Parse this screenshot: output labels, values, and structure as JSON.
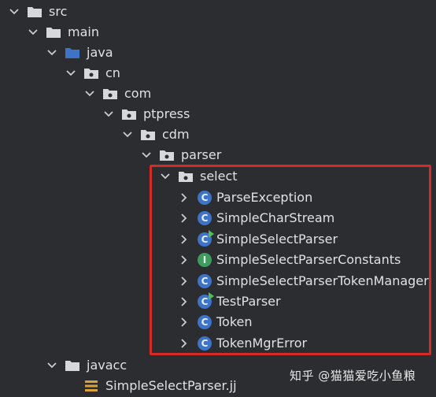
{
  "tree": {
    "src": "src",
    "main": "main",
    "java": "java",
    "cn": "cn",
    "com": "com",
    "ptpress": "ptpress",
    "cdm": "cdm",
    "parser": "parser",
    "select": "select",
    "classes": [
      {
        "label": "ParseException",
        "kind": "C"
      },
      {
        "label": "SimpleCharStream",
        "kind": "C"
      },
      {
        "label": "SimpleSelectParser",
        "kind": "C"
      },
      {
        "label": "SimpleSelectParserConstants",
        "kind": "I"
      },
      {
        "label": "SimpleSelectParserTokenManager",
        "kind": "C"
      },
      {
        "label": "TestParser",
        "kind": "C"
      },
      {
        "label": "Token",
        "kind": "C"
      },
      {
        "label": "TokenMgrError",
        "kind": "C"
      }
    ],
    "javacc": "javacc",
    "grammar_file": "SimpleSelectParser.jj"
  },
  "watermark": "知乎 @猫猫爱吃小鱼粮",
  "colors": {
    "background": "#2b2d30",
    "text": "#dfe1e5",
    "class_icon": "#3d74c7",
    "interface_icon": "#3f9a5e",
    "highlight_border": "#d42b24",
    "run_badge": "#4fbf5a"
  }
}
